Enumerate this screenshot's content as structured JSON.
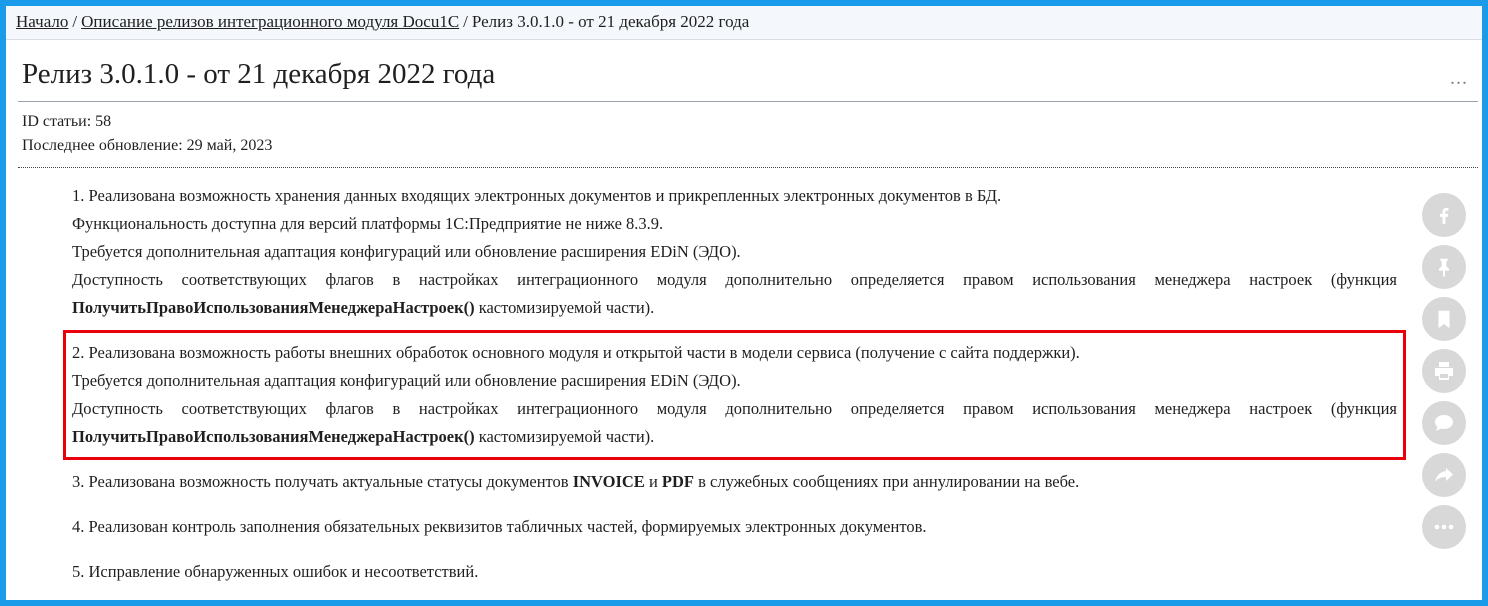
{
  "breadcrumb": {
    "home": "Начало",
    "section": "Описание релизов интеграционного модуля Docu1C",
    "current": "Релиз 3.0.1.0 - от 21 декабря 2022 года",
    "separator": "/"
  },
  "article": {
    "title": "Релиз 3.0.1.0 - от 21 декабря 2022 года",
    "more": "...",
    "id_label": "ID статьи: 58",
    "updated_label": "Последнее обновление: 29 май, 2023"
  },
  "items": [
    {
      "lines": [
        "1. Реализована возможность хранения данных входящих электронных документов и прикрепленных электронных документов в БД.",
        "Функциональность доступна для версий платформы 1С:Предприятие не ниже 8.3.9.",
        "Требуется дополнительная адаптация конфигураций или обновление расширения EDiN (ЭДО).",
        "Доступность соответствующих флагов в настройках интеграционного модуля дополнительно определяется правом использования менеджера настроек (функция "
      ],
      "func_name": "ПолучитьПравоИспользованияМенеджераНастроек()",
      "func_tail": " кастомизируемой части)."
    },
    {
      "lines": [
        "2. Реализована возможность работы внешних обработок основного модуля и открытой части в модели сервиса (получение с сайта поддержки).",
        "Требуется дополнительная адаптация конфигураций или обновление расширения EDiN (ЭДО).",
        "Доступность соответствующих флагов в настройках интеграционного модуля дополнительно определяется правом использования менеджера настроек (функция "
      ],
      "func_name": "ПолучитьПравоИспользованияМенеджераНастроек()",
      "func_tail": " кастомизируемой части)."
    },
    {
      "prefix": "3. Реализована возможность получать актуальные статусы документов ",
      "b1": "INVOICE",
      "mid": " и ",
      "b2": "PDF",
      "suffix": " в служебных сообщениях при аннулировании на вебе."
    },
    {
      "text": "4. Реализован контроль заполнения обязательных реквизитов табличных частей, формируемых электронных документов."
    },
    {
      "text": "5. Исправление обнаруженных ошибок и несоответствий."
    }
  ],
  "share": [
    "facebook-icon",
    "pin-icon",
    "bookmark-icon",
    "print-icon",
    "comment-icon",
    "share-icon",
    "more-icon"
  ],
  "colors": {
    "frame": "#1a9bea",
    "highlight": "#e8000b",
    "share_bg": "#d8d8d8"
  }
}
